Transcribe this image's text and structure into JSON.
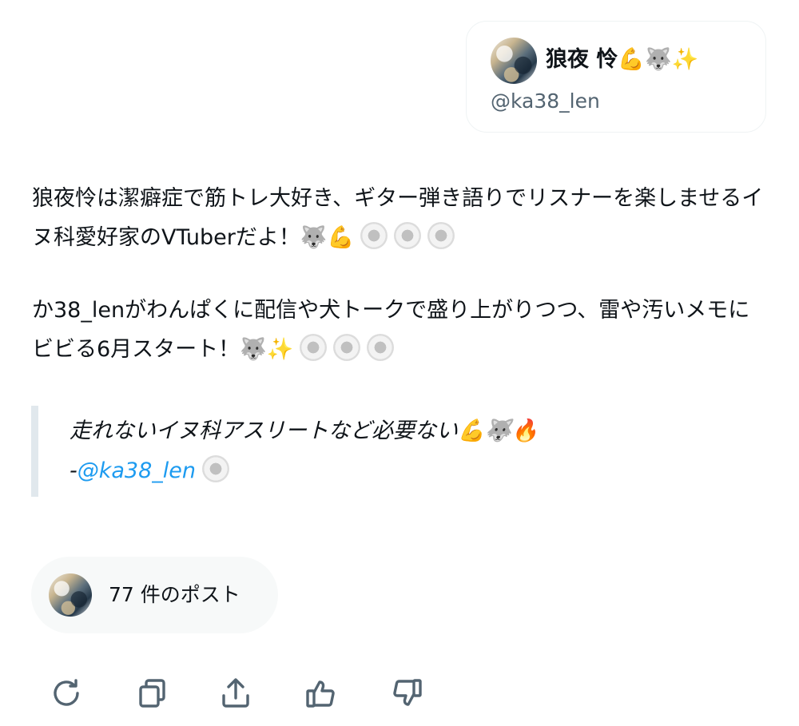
{
  "profile": {
    "display_name": "狼夜 怜💪🐺✨",
    "handle": "@ka38_len"
  },
  "bio": {
    "paragraph_1": "狼夜怜は潔癖症で筋トレ大好き、ギター弾き語りでリスナーを楽しませるイヌ科愛好家のVTuberだよ！",
    "paragraph_1_emoji": "🐺💪",
    "paragraph_2": "か38_lenがわんぱくに配信や犬トークで盛り上がりつつ、雷や汚いメモにビビる6月スタート！",
    "paragraph_2_emoji": "🐺✨"
  },
  "quote": {
    "text": "走れないイヌ科アスリートなど必要ない💪🐺🔥",
    "dash": "-",
    "attribution": "@ka38_len"
  },
  "post_count": {
    "label": "77 件のポスト"
  },
  "actions": [
    {
      "icon": "refresh-icon"
    },
    {
      "icon": "copy-icon"
    },
    {
      "icon": "share-icon"
    },
    {
      "icon": "thumbs-up-icon"
    },
    {
      "icon": "thumbs-down-icon"
    }
  ],
  "colors": {
    "text": "#0f1419",
    "secondary_text": "#536471",
    "link": "#1d9bf0",
    "icon": "#536471",
    "quote_bar": "#e1e8ed",
    "pill_bg": "#f7f9f9"
  }
}
